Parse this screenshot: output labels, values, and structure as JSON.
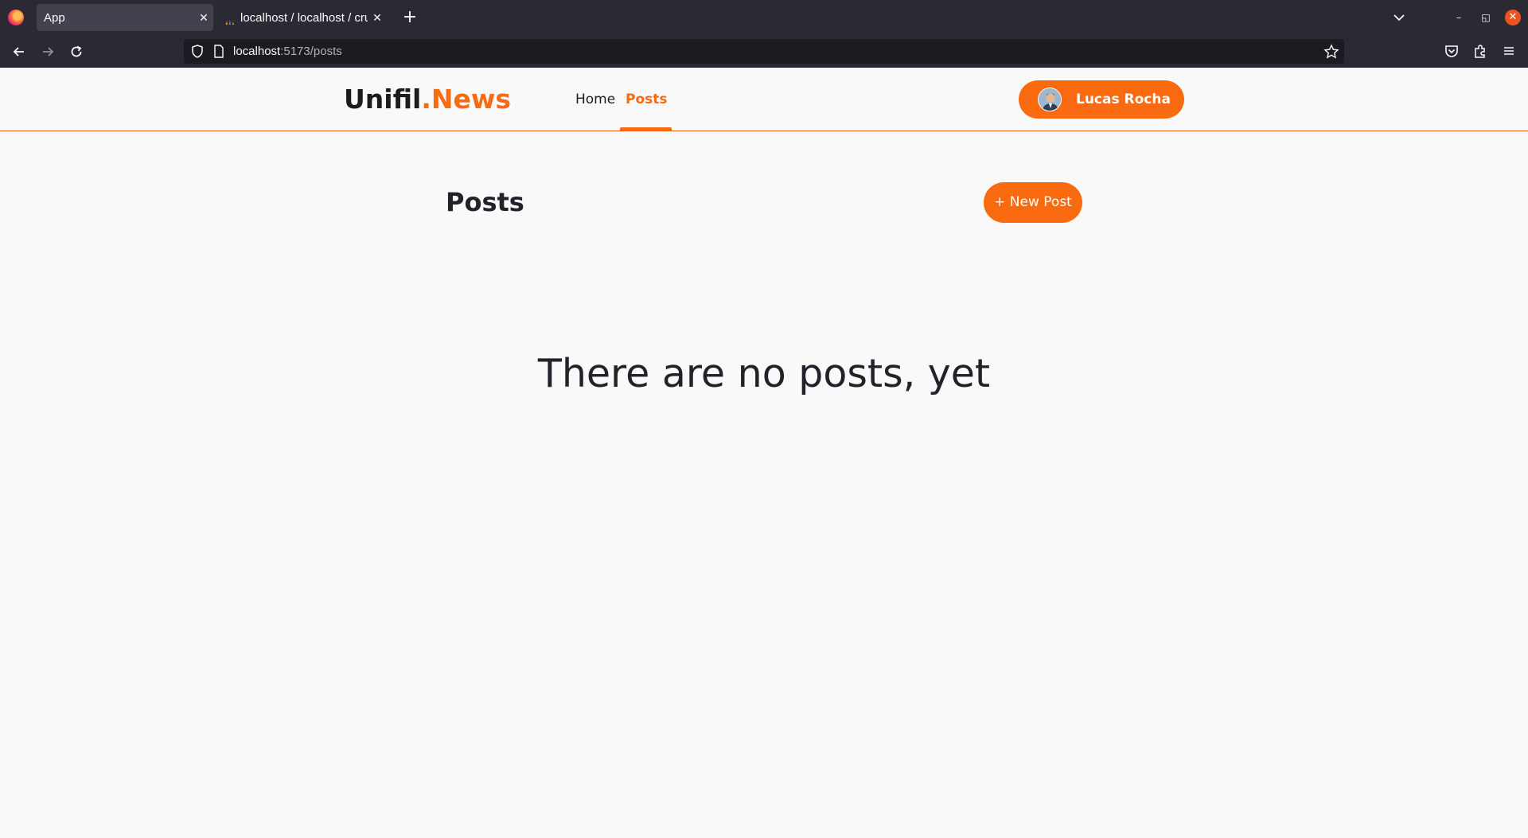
{
  "browser": {
    "tabs": [
      {
        "label": "App",
        "active": true
      },
      {
        "label": "localhost / localhost / cru",
        "active": false
      }
    ],
    "url_host": "localhost",
    "url_rest": ":5173/posts"
  },
  "header": {
    "brand_main": "Unifil",
    "brand_accent": ".News",
    "nav": [
      {
        "label": "Home",
        "active": false
      },
      {
        "label": "Posts",
        "active": true
      }
    ],
    "user_name": "Lucas Rocha"
  },
  "main": {
    "title": "Posts",
    "new_post_label": "+ New Post",
    "empty_message": "There are no posts, yet"
  },
  "colors": {
    "accent": "#f96a11",
    "chrome": "#2b2a33",
    "page_bg": "#f9f9f9",
    "text": "#22222a"
  }
}
